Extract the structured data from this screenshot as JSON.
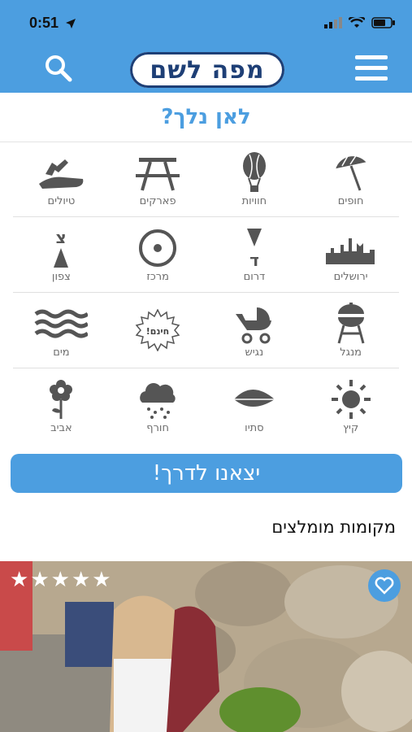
{
  "status": {
    "time": "0:51"
  },
  "header": {
    "logo_text": "מפה לשם"
  },
  "where_title": "לאן נלך?",
  "categories": [
    {
      "label": "חופים",
      "icon": "umbrella-icon"
    },
    {
      "label": "חוויות",
      "icon": "hot-air-balloon-icon"
    },
    {
      "label": "פארקים",
      "icon": "picnic-table-icon"
    },
    {
      "label": "טיולים",
      "icon": "hiking-boot-icon"
    },
    {
      "label": "ירושלים",
      "icon": "jerusalem-skyline-icon"
    },
    {
      "label": "דרום",
      "icon": "south-arrow-icon",
      "glyph": "ד"
    },
    {
      "label": "מרכז",
      "icon": "center-target-icon"
    },
    {
      "label": "צפון",
      "icon": "north-arrow-icon",
      "glyph": "צ"
    },
    {
      "label": "מנגל",
      "icon": "grill-icon"
    },
    {
      "label": "נגיש",
      "icon": "stroller-icon"
    },
    {
      "label": "חינם!",
      "icon": "free-burst-icon",
      "glyph": "חינם!",
      "is_badge": true
    },
    {
      "label": "מים",
      "icon": "water-waves-icon"
    },
    {
      "label": "קיץ",
      "icon": "sun-icon"
    },
    {
      "label": "סתיו",
      "icon": "leaf-icon"
    },
    {
      "label": "חורף",
      "icon": "rain-cloud-icon"
    },
    {
      "label": "אביב",
      "icon": "flower-icon"
    }
  ],
  "go_button": "יצאנו לדרך!",
  "recommended_title": "מקומות מומלצים",
  "recommended": {
    "stars": 5
  },
  "colors": {
    "brand_blue": "#4c9ee0",
    "logo_navy": "#1e3f76",
    "icon_gray": "#555555"
  }
}
